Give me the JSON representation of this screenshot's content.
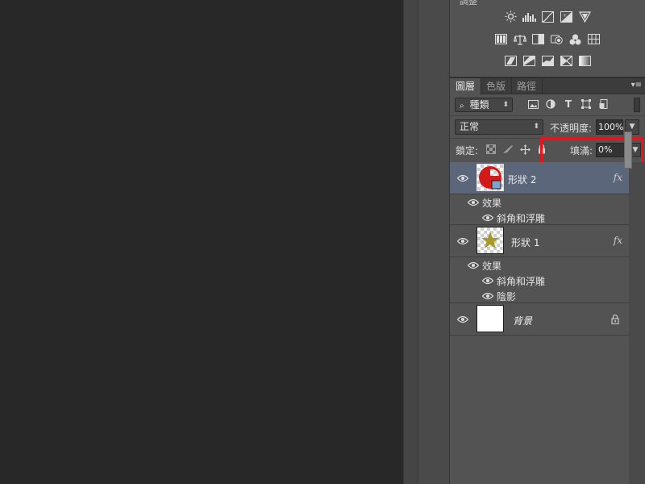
{
  "adjustments": {
    "title": "調整",
    "row1": [
      "brightness-icon",
      "levels-icon",
      "curves-icon",
      "exposure-icon",
      "vibrance-icon"
    ],
    "row2": [
      "hue-saturation-icon",
      "color-balance-icon",
      "black-white-icon",
      "photo-filter-icon",
      "channel-mixer-icon",
      "color-lookup-icon"
    ],
    "row3": [
      "invert-icon",
      "posterize-icon",
      "threshold-icon",
      "selective-color-icon",
      "gradient-map-icon"
    ]
  },
  "tabs": [
    {
      "label": "圖層",
      "active": true
    },
    {
      "label": "色版",
      "active": false
    },
    {
      "label": "路徑",
      "active": false
    }
  ],
  "filter": {
    "value": "種類"
  },
  "blend": {
    "value": "正常"
  },
  "opacity": {
    "label": "不透明度:",
    "value": "100%"
  },
  "lock": {
    "label": "鎖定:"
  },
  "fill": {
    "label": "填滿:",
    "value": "0%",
    "slider_fraction": 0.0
  },
  "layers": [
    {
      "name": "形狀 2",
      "selected": true,
      "fx": "fx",
      "effects_label": "效果",
      "effects": [
        "斜角和浮雕"
      ]
    },
    {
      "name": "形狀 1",
      "selected": false,
      "fx": "fx",
      "effects_label": "效果",
      "effects": [
        "斜角和浮雕",
        "陰影"
      ]
    },
    {
      "name": "背景",
      "selected": false,
      "locked": true
    }
  ],
  "colors": {
    "highlight": "#e8141b",
    "selected_row": "#5b667a",
    "shape2": "#d21a1a",
    "shape1_star": "#a89a2a"
  }
}
